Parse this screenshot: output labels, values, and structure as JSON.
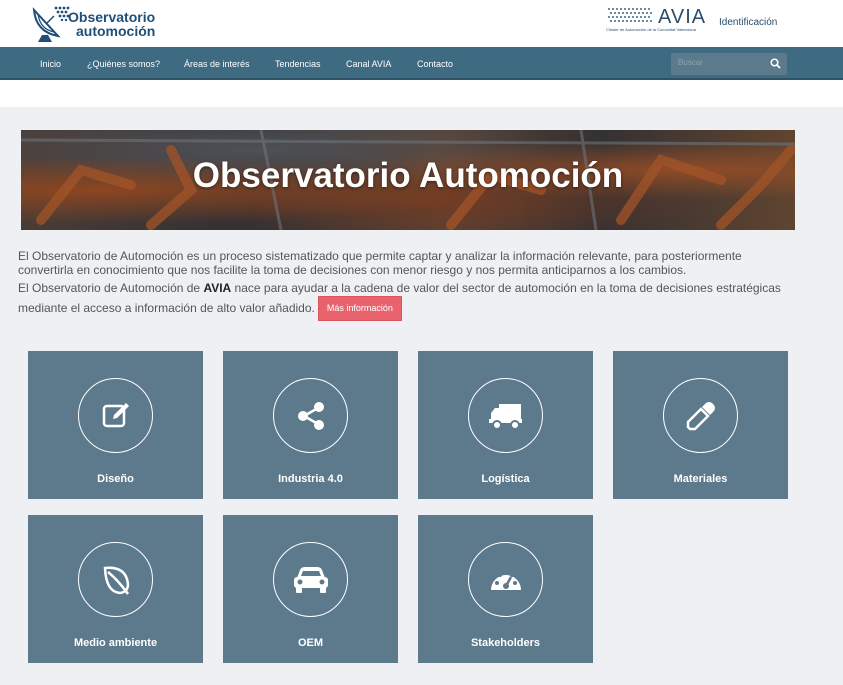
{
  "header": {
    "logo_line1": "Observatorio",
    "logo_line2": "automoción",
    "avia_word": "AVIA",
    "avia_subtitle": "Clúster de Automoción de la Comunitat Valenciana",
    "identification": "Identificación"
  },
  "nav": {
    "items": [
      "Inicio",
      "¿Quiénes somos?",
      "Áreas de interés",
      "Tendencias",
      "Canal AVIA",
      "Contacto"
    ],
    "search_placeholder": "Buscar"
  },
  "hero": {
    "title": "Observatorio Automoción"
  },
  "intro": {
    "p1": "El Observatorio de Automoción es un proceso sistematizado que permite captar y analizar la información relevante, para posteriormente convertirla en conocimiento que nos facilite la toma de decisiones con menor riesgo y nos permita anticiparnos a los cambios.",
    "p2_before": "El Observatorio de Automoción de ",
    "p2_bold": "AVIA",
    "p2_after": " nace para ayudar a la cadena de valor del sector de automoción en la toma de decisiones estratégicas mediante el acceso a información de alto valor añadido.",
    "more_button": "Más información"
  },
  "tiles": [
    {
      "label": "Diseño",
      "icon": "edit-icon"
    },
    {
      "label": "Industria 4.0",
      "icon": "share-icon"
    },
    {
      "label": "Logística",
      "icon": "truck-icon"
    },
    {
      "label": "Materiales",
      "icon": "eyedropper-icon"
    },
    {
      "label": "Medio ambiente",
      "icon": "leaf-icon"
    },
    {
      "label": "OEM",
      "icon": "car-icon"
    },
    {
      "label": "Stakeholders",
      "icon": "dashboard-icon"
    }
  ],
  "colors": {
    "nav_bg": "#3e6a82",
    "tile_bg": "#5c7a8c",
    "button_bg": "#e8636e",
    "content_bg": "#eef0f4"
  }
}
